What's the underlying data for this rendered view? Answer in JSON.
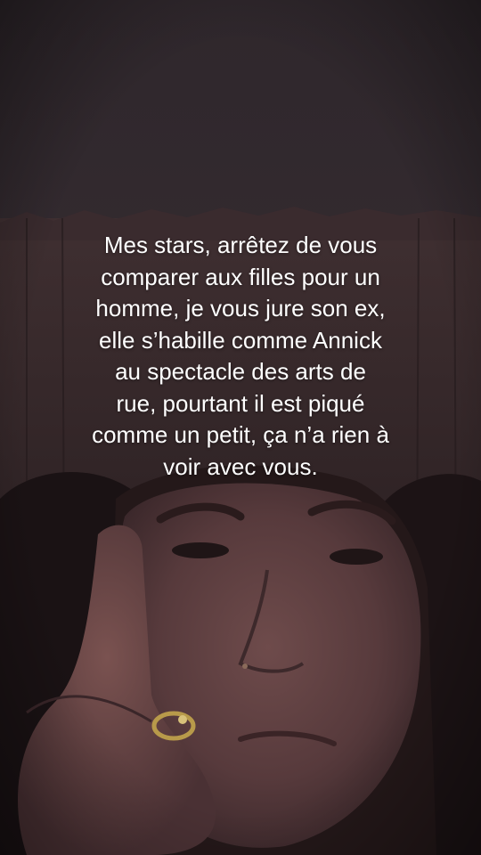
{
  "caption": {
    "lines": [
      "Mes stars, arrêtez de vous",
      "comparer aux filles pour un",
      "homme, je vous jure son ex,",
      "elle s’habille comme Annick",
      "au spectacle des arts de",
      "rue, pourtant il est piqué",
      "comme un petit, ça n’a rien à",
      "voir avec vous."
    ]
  },
  "colors": {
    "sky": "#3a3036",
    "fence": "#35282b",
    "skin": "#5e3f41",
    "text": "#ffffff"
  }
}
